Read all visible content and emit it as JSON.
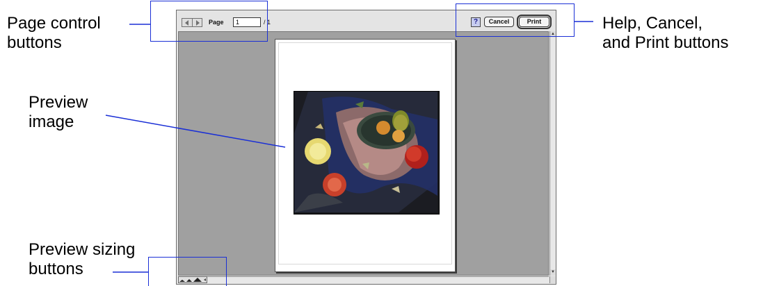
{
  "callouts": {
    "page_controls": [
      "Page control",
      "buttons"
    ],
    "help_cancel_print": [
      "Help, Cancel,",
      "and Print buttons"
    ],
    "preview_image": [
      "Preview",
      "image"
    ],
    "preview_sizing": [
      "Preview sizing",
      "buttons"
    ]
  },
  "toolbar": {
    "page_label": "Page",
    "page_value": "1",
    "page_separator": "/ 1",
    "help_label": "?",
    "cancel_label": "Cancel",
    "print_label": "Print"
  },
  "colors": {
    "callout_line": "#1a2fd6",
    "preview_background": "#a0a0a0",
    "paper": "#ffffff"
  },
  "icons": {
    "prev_page": "triangle-left-icon",
    "next_page": "triangle-right-icon",
    "sizing_small": "mountain-small-icon",
    "sizing_medium": "mountain-medium-icon",
    "sizing_large": "mountain-large-icon"
  }
}
